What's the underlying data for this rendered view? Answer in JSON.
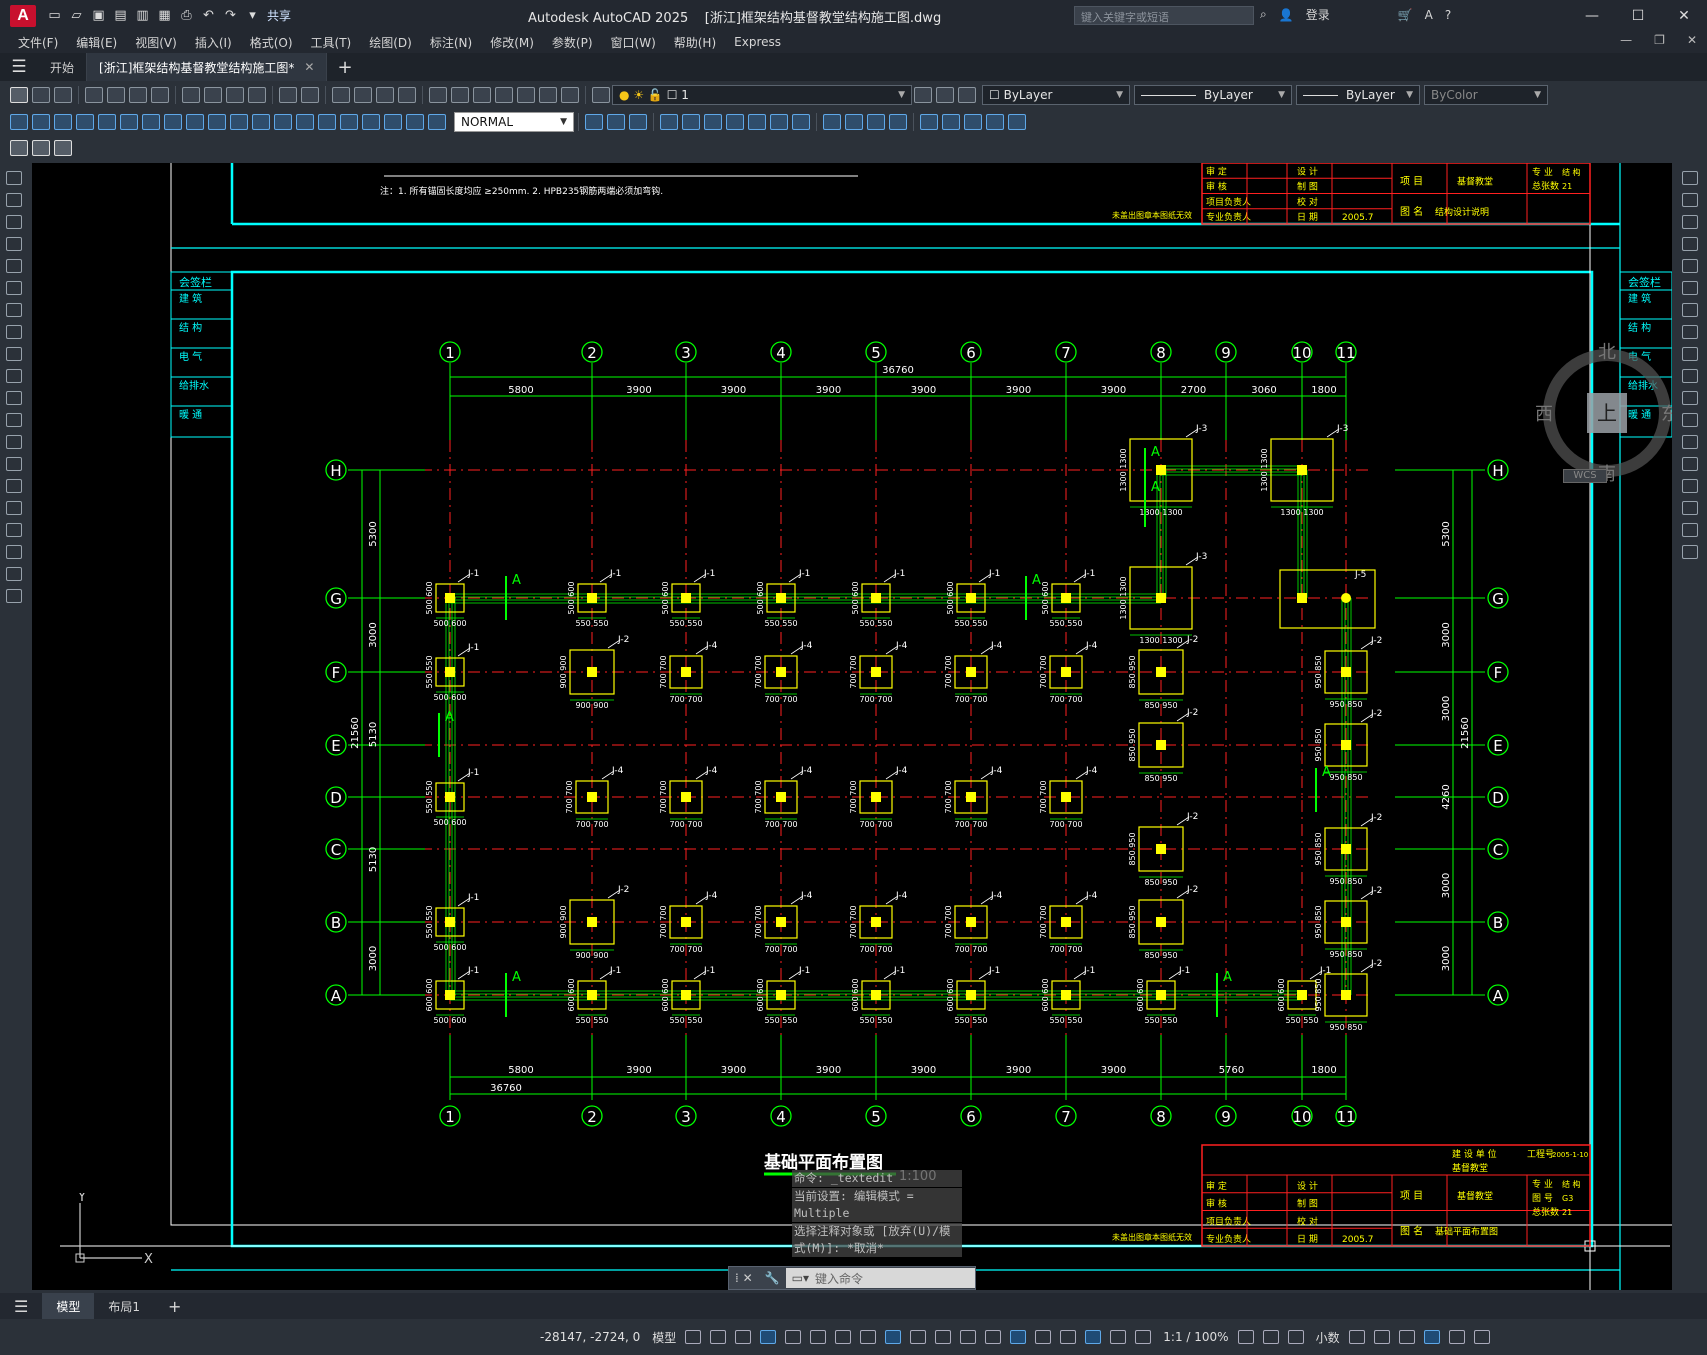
{
  "app": {
    "logo": "A",
    "share": "共享",
    "title_app": "Autodesk AutoCAD 2025",
    "title_file": "[浙江]框架结构基督教堂结构施工图.dwg",
    "search_placeholder": "键入关键字或短语",
    "login": "登录",
    "menu": [
      "文件(F)",
      "编辑(E)",
      "视图(V)",
      "插入(I)",
      "格式(O)",
      "工具(T)",
      "绘图(D)",
      "标注(N)",
      "修改(M)",
      "参数(P)",
      "窗口(W)",
      "帮助(H)",
      "Express"
    ]
  },
  "tabs": {
    "start": "开始",
    "doc": "[浙江]框架结构基督教堂结构施工图*"
  },
  "props": {
    "layer": "1",
    "textstyle": "NORMAL",
    "color": "ByLayer",
    "linetype": "ByLayer",
    "lineweight": "ByLayer",
    "plotstyle": "ByColor"
  },
  "drawing": {
    "grid_cols": [
      "1",
      "2",
      "3",
      "4",
      "5",
      "6",
      "7",
      "8",
      "9",
      "10",
      "11"
    ],
    "grid_rows": [
      "H",
      "G",
      "F",
      "E",
      "D",
      "C",
      "B",
      "A"
    ],
    "top_total": "36760",
    "bottom_total": "36760",
    "top_dims": [
      "5800",
      "3900",
      "3900",
      "3900",
      "3900",
      "3900",
      "3900",
      "2700",
      "3060",
      "1800"
    ],
    "bottom_dims": [
      "5800",
      "3900",
      "3900",
      "3900",
      "3900",
      "3900",
      "3900",
      "5760",
      "1800"
    ],
    "left_dims": [
      "5300",
      "3000",
      "5130",
      "5130",
      "3000"
    ],
    "left_total": "21560",
    "right_dims": [
      "5300",
      "3000",
      "3000",
      "4260",
      "3000",
      "3000"
    ],
    "right_total": "21560",
    "top_note": "注：1. 所有锚固长度均应 ≥250mm.    2. HPB235钢筋两端必须加弯钩.",
    "title": "基础平面布置图",
    "scale": "1:100",
    "sign_header": "会签栏",
    "sign_items": [
      "建 筑",
      "结 构",
      "电 气",
      "给排水",
      "暖 通"
    ],
    "tb_top": {
      "labels": [
        "审 定",
        "审 核",
        "项目负责人",
        "专业负责人"
      ],
      "mid": [
        "设 计",
        "制 图",
        "校 对",
        "日 期"
      ],
      "date": "2005.7",
      "proj": "项 目",
      "proj_val": "基督教堂",
      "fig": "图 名",
      "fig_val": "结构设计说明",
      "left_note": "未盖出图章本图纸无效",
      "right": [
        "专 业",
        "总张数"
      ],
      "right_vals": [
        "结 构",
        "21"
      ]
    },
    "tb_bottom": {
      "owner": "建 设 单 位",
      "owner_val": "基督教堂",
      "proj_no": "工程号",
      "proj_no_val": "2005-1-10",
      "labels": [
        "审 定",
        "审 核",
        "项目负责人",
        "专业负责人"
      ],
      "mid": [
        "设 计",
        "制 图",
        "校 对",
        "日 期"
      ],
      "date": "2005.7",
      "proj": "项 目",
      "proj_val": "基督教堂",
      "fig": "图 名",
      "fig_val": "基础平面布置图",
      "left_note": "未盖出图章本图纸无效",
      "right": [
        "专 业",
        "图 号",
        "总张数"
      ],
      "right_vals": [
        "结 构",
        "G3",
        "21"
      ]
    },
    "footings": {
      "J1": "J-1",
      "J2": "J-2",
      "J3": "J-3",
      "J4": "J-4",
      "J5": "J-5"
    }
  },
  "viewcube": {
    "n": "北",
    "s": "南",
    "e": "东",
    "w": "西",
    "top": "上",
    "wcs": "WCS"
  },
  "command": {
    "lines": [
      "命令: _textedit",
      "当前设置: 编辑模式 = Multiple",
      "选择注释对象或 [放弃(U)/模式(M)]: *取消*"
    ],
    "placeholder": "键入命令"
  },
  "layouts": {
    "model": "模型",
    "layout1": "布局1"
  },
  "status": {
    "coords": "-28147, -2724, 0",
    "model": "模型",
    "scale": "1:1 / 100%",
    "units": "小数"
  }
}
